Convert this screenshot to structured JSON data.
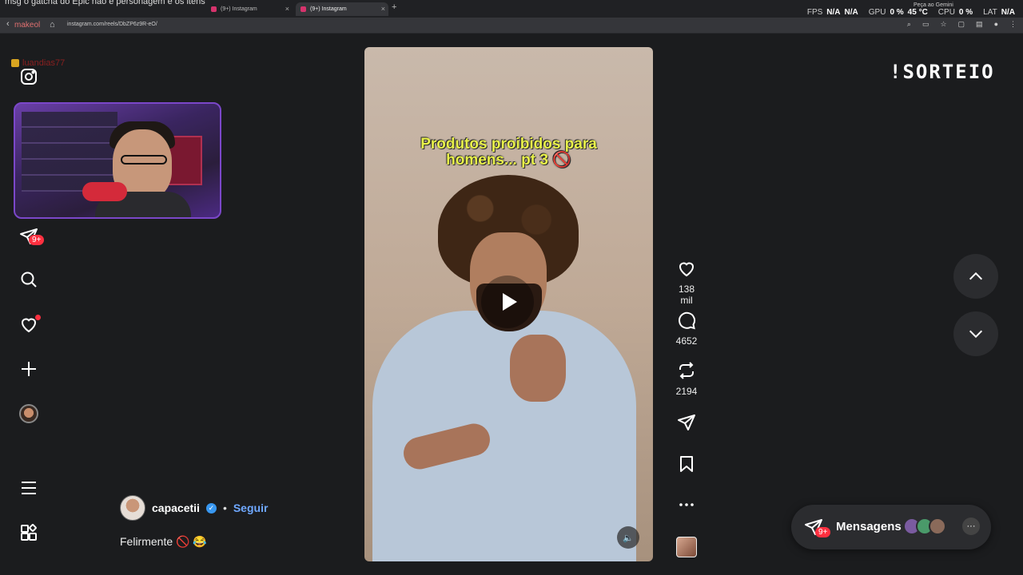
{
  "browser": {
    "ticker": "msg o gatcha do Epic não é personagem e os itens",
    "tabs": [
      {
        "label": "(9+) Instagram",
        "active": false
      },
      {
        "label": "(9+) Instagram",
        "active": true
      }
    ],
    "new_tab": "+",
    "url": "instagram.com/reels/DbZP6z9R-eO/",
    "prefix": "makeol",
    "gemini": "Peça ao Gemini",
    "stats": {
      "fps_label": "FPS",
      "fps_val1": "N/A",
      "fps_val2": "N/A",
      "gpu_label": "GPU",
      "gpu_pct": "0 %",
      "gpu_temp": "45 °C",
      "cpu_label": "CPU",
      "cpu_pct": "0 %",
      "lat_label": "LAT",
      "lat_val": "N/A"
    }
  },
  "stream": {
    "username": "luandias77",
    "sorteio": "!SORTEIO"
  },
  "sidebar": {
    "notifications_badge": "9+"
  },
  "reel": {
    "overlay_text_line1": "Produtos proibidos para",
    "overlay_text_line2": "homens... pt 3 🚫",
    "likes": "138 mil",
    "comments": "4652",
    "reposts": "2194",
    "author": "capacetii",
    "follow": "Seguir",
    "separator": "•",
    "caption": "Felirmente 🚫 😂"
  },
  "messages": {
    "label": "Mensagens",
    "badge": "9+",
    "more": "···"
  },
  "colors": {
    "accent_red": "#ff3040",
    "follow_blue": "#6fa8ff",
    "verified_blue": "#3897f0",
    "overlay_yellow": "#e9f24a"
  }
}
